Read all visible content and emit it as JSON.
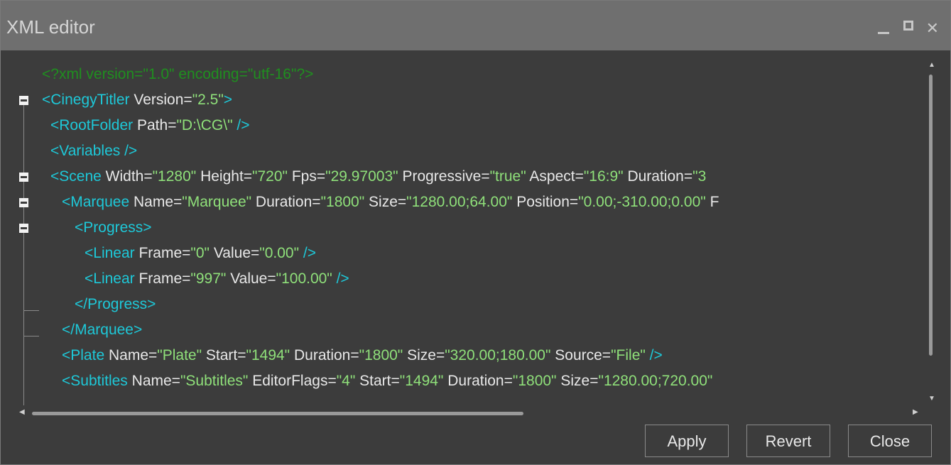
{
  "window": {
    "title": "XML editor",
    "controls": {
      "minimize_icon": "minimize-icon",
      "maximize_icon": "maximize-icon",
      "close_icon": "close-icon",
      "close_glyph": "✕"
    }
  },
  "editor": {
    "lines": [
      {
        "tokens": [
          {
            "t": "proc",
            "v": "<?xml version=\"1.0\" encoding=\"utf-16\"?>"
          }
        ]
      },
      {
        "tokens": [
          {
            "t": "tag",
            "v": "<CinegyTitler"
          },
          {
            "t": "attr",
            "v": " Version="
          },
          {
            "t": "val",
            "v": "\"2.5\""
          },
          {
            "t": "tag",
            "v": ">"
          }
        ]
      },
      {
        "tokens": [
          {
            "t": "tag",
            "v": "<RootFolder"
          },
          {
            "t": "attr",
            "v": " Path="
          },
          {
            "t": "val",
            "v": "\"D:\\CG\\\""
          },
          {
            "t": "tag",
            "v": " />"
          }
        ]
      },
      {
        "tokens": [
          {
            "t": "tag",
            "v": "<Variables />"
          }
        ]
      },
      {
        "tokens": [
          {
            "t": "tag",
            "v": "<Scene"
          },
          {
            "t": "attr",
            "v": " Width="
          },
          {
            "t": "val",
            "v": "\"1280\""
          },
          {
            "t": "attr",
            "v": " Height="
          },
          {
            "t": "val",
            "v": "\"720\""
          },
          {
            "t": "attr",
            "v": " Fps="
          },
          {
            "t": "val",
            "v": "\"29.97003\""
          },
          {
            "t": "attr",
            "v": " Progressive="
          },
          {
            "t": "val",
            "v": "\"true\""
          },
          {
            "t": "attr",
            "v": " Aspect="
          },
          {
            "t": "val",
            "v": "\"16:9\""
          },
          {
            "t": "attr",
            "v": " Duration="
          },
          {
            "t": "val",
            "v": "\"3"
          }
        ]
      },
      {
        "tokens": [
          {
            "t": "tag",
            "v": "<Marquee"
          },
          {
            "t": "attr",
            "v": " Name="
          },
          {
            "t": "val",
            "v": "\"Marquee\""
          },
          {
            "t": "attr",
            "v": " Duration="
          },
          {
            "t": "val",
            "v": "\"1800\""
          },
          {
            "t": "attr",
            "v": " Size="
          },
          {
            "t": "val",
            "v": "\"1280.00;64.00\""
          },
          {
            "t": "attr",
            "v": " Position="
          },
          {
            "t": "val",
            "v": "\"0.00;-310.00;0.00\""
          },
          {
            "t": "attr",
            "v": " F"
          }
        ]
      },
      {
        "tokens": [
          {
            "t": "tag",
            "v": "<Progress>"
          }
        ]
      },
      {
        "tokens": [
          {
            "t": "tag",
            "v": "<Linear"
          },
          {
            "t": "attr",
            "v": " Frame="
          },
          {
            "t": "val",
            "v": "\"0\""
          },
          {
            "t": "attr",
            "v": " Value="
          },
          {
            "t": "val",
            "v": "\"0.00\""
          },
          {
            "t": "tag",
            "v": " />"
          }
        ]
      },
      {
        "tokens": [
          {
            "t": "tag",
            "v": "<Linear"
          },
          {
            "t": "attr",
            "v": " Frame="
          },
          {
            "t": "val",
            "v": "\"997\""
          },
          {
            "t": "attr",
            "v": " Value="
          },
          {
            "t": "val",
            "v": "\"100.00\""
          },
          {
            "t": "tag",
            "v": " />"
          }
        ]
      },
      {
        "tokens": [
          {
            "t": "tag",
            "v": "</Progress>"
          }
        ]
      },
      {
        "tokens": [
          {
            "t": "tag",
            "v": "</Marquee>"
          }
        ]
      },
      {
        "tokens": [
          {
            "t": "tag",
            "v": "<Plate"
          },
          {
            "t": "attr",
            "v": " Name="
          },
          {
            "t": "val",
            "v": "\"Plate\""
          },
          {
            "t": "attr",
            "v": " Start="
          },
          {
            "t": "val",
            "v": "\"1494\""
          },
          {
            "t": "attr",
            "v": " Duration="
          },
          {
            "t": "val",
            "v": "\"1800\""
          },
          {
            "t": "attr",
            "v": " Size="
          },
          {
            "t": "val",
            "v": "\"320.00;180.00\""
          },
          {
            "t": "attr",
            "v": " Source="
          },
          {
            "t": "val",
            "v": "\"File\""
          },
          {
            "t": "tag",
            "v": " />"
          }
        ]
      },
      {
        "tokens": [
          {
            "t": "tag",
            "v": "<Subtitles"
          },
          {
            "t": "attr",
            "v": " Name="
          },
          {
            "t": "val",
            "v": "\"Subtitles\""
          },
          {
            "t": "attr",
            "v": " EditorFlags="
          },
          {
            "t": "val",
            "v": "\"4\""
          },
          {
            "t": "attr",
            "v": " Start="
          },
          {
            "t": "val",
            "v": "\"1494\""
          },
          {
            "t": "attr",
            "v": " Duration="
          },
          {
            "t": "val",
            "v": "\"1800\""
          },
          {
            "t": "attr",
            "v": " Size="
          },
          {
            "t": "val",
            "v": "\"1280.00;720.00\""
          }
        ]
      }
    ]
  },
  "buttons": {
    "apply": "Apply",
    "revert": "Revert",
    "close": "Close"
  },
  "colors": {
    "proc": "#1f8f1f",
    "tag": "#1ec8d8",
    "attr": "#e8e8e8",
    "val": "#8fe07a"
  }
}
